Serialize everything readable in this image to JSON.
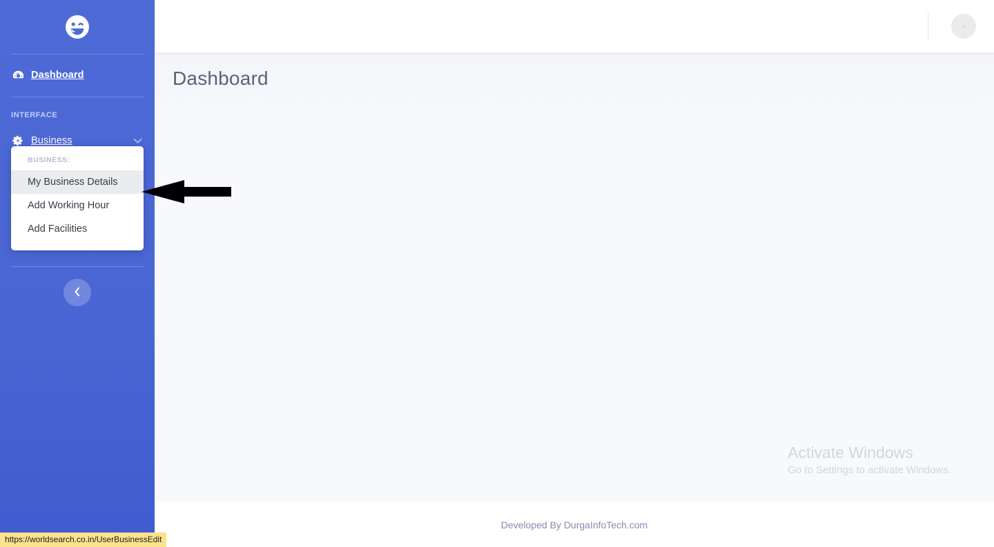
{
  "sidebar": {
    "logo_icon": "winking-smiley-face-icon",
    "nav": [
      {
        "label": "Dashboard",
        "icon": "tachometer-icon"
      }
    ],
    "section_heading": "INTERFACE",
    "collapsible": {
      "label": "Business",
      "icon": "gear-icon",
      "chevron_icon": "chevron-down-icon"
    },
    "dropdown": {
      "heading": "BUSINESS:",
      "items": [
        {
          "label": "My Business Details",
          "active": true
        },
        {
          "label": "Add Working Hour",
          "active": false
        },
        {
          "label": "Add Facilities",
          "active": false
        }
      ]
    },
    "toggle": {
      "icon": "chevron-left-icon"
    },
    "accent_color": "#4e6ad6"
  },
  "topbar": {
    "avatar_icon": "user-avatar-placeholder",
    "divider": true
  },
  "main": {
    "page_title": "Dashboard"
  },
  "watermark": {
    "title": "Activate Windows",
    "subtitle": "Go to Settings to activate Windows."
  },
  "footer": {
    "text": "Developed By DurgaInfoTech.com"
  },
  "annotation": {
    "arrow_icon": "left-arrow-annotation",
    "color": "#000000"
  },
  "status_bar": {
    "url": "https://worldsearch.co.in/UserBusinessEdit"
  }
}
